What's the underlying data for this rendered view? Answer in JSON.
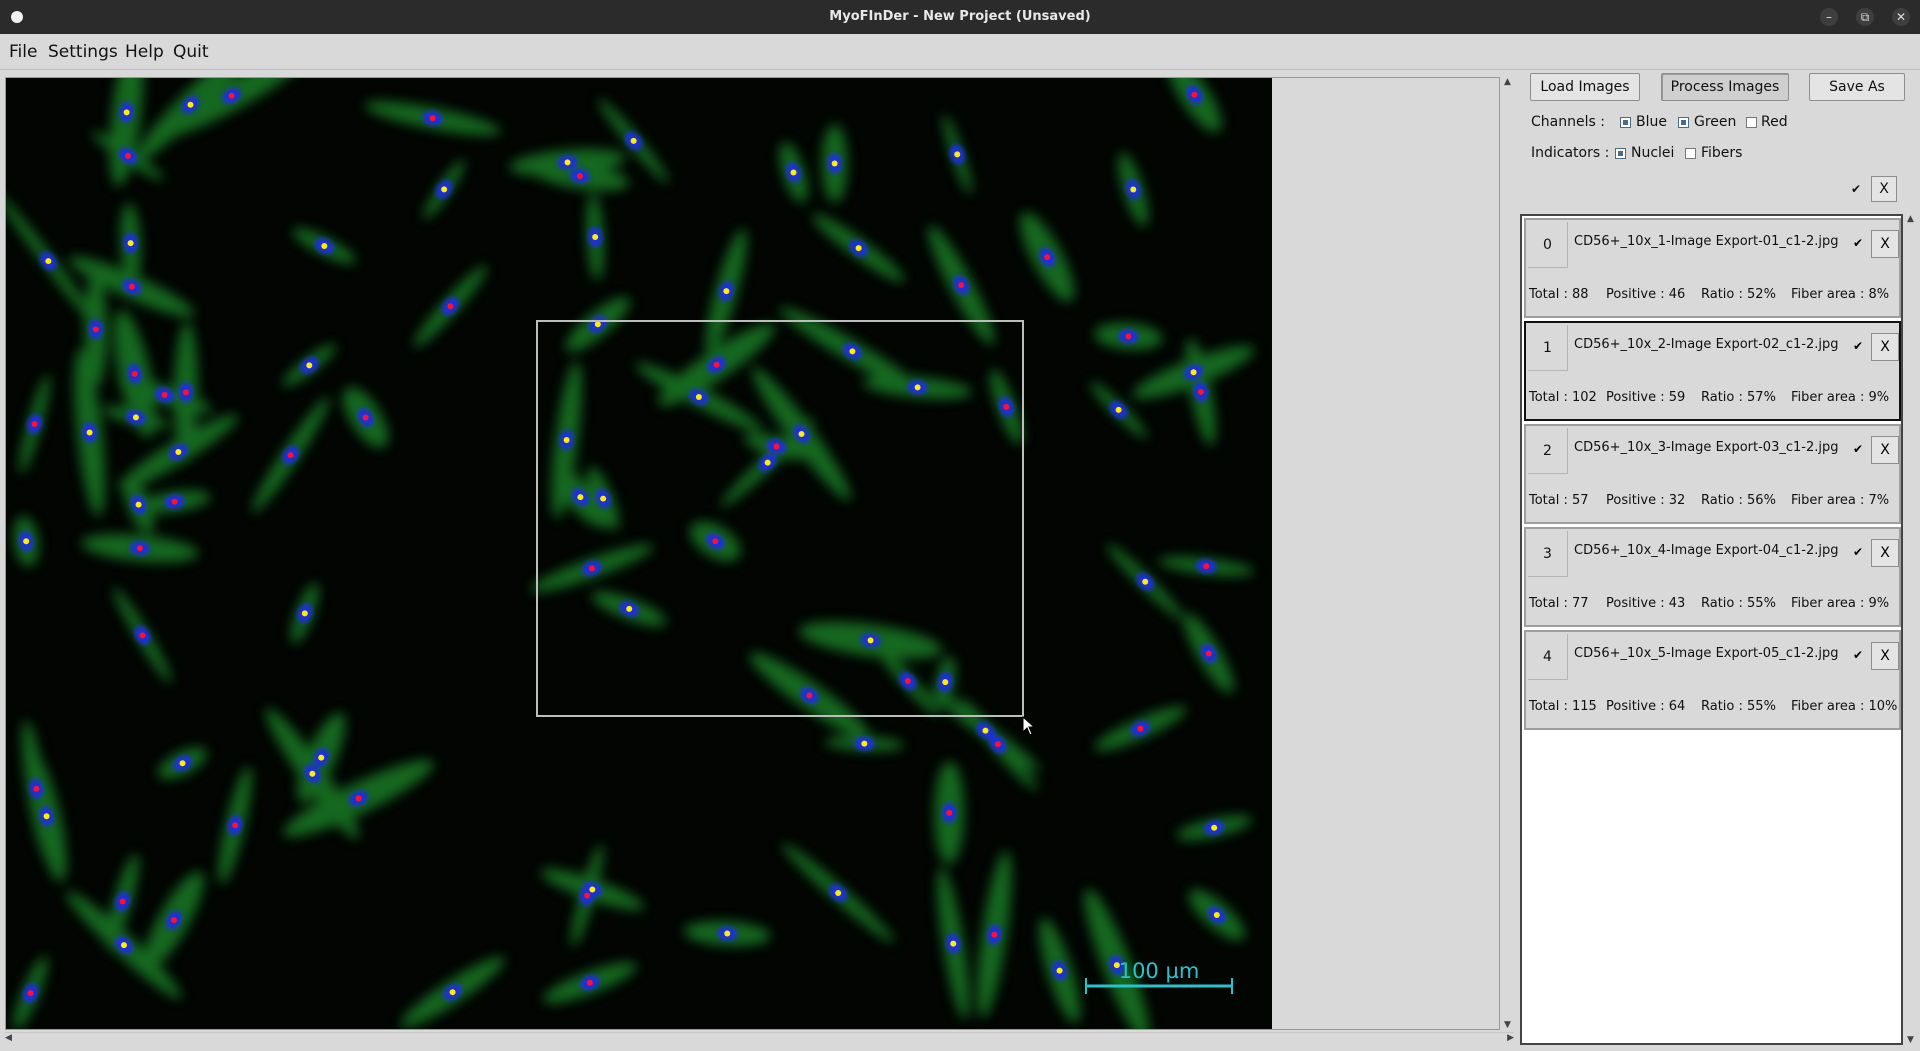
{
  "window": {
    "title": "MyoFInDer - New Project (Unsaved)",
    "controls": {
      "minimize": "–",
      "restore": "⧉",
      "close": "✕"
    }
  },
  "menu": {
    "file": "File",
    "settings": "Settings",
    "help": "Help",
    "quit": "Quit"
  },
  "toolbar": {
    "load": "Load Images",
    "process": "Process Images",
    "save": "Save As"
  },
  "channels": {
    "label": "Channels :",
    "blue": "Blue",
    "green": "Green",
    "red": "Red",
    "blue_on": true,
    "green_on": true,
    "red_on": false
  },
  "indicators": {
    "label": "Indicators :",
    "nuclei": "Nuclei",
    "fibers": "Fibers",
    "nuclei_on": true,
    "fibers_on": false
  },
  "select_all": {
    "check": "✔",
    "close": "X"
  },
  "scale_bar": {
    "text": "100 µm",
    "color": "#27c4cf"
  },
  "colors": {
    "nucleus": "#1c2ee0",
    "fiber": "#1e8a2a",
    "positive": "#ffee00",
    "negative": "#ff1030"
  },
  "images": [
    {
      "index": "0",
      "name": "CD56+_10x_1-Image Export-01_c1-2.jpg",
      "check": "✔",
      "close": "X",
      "total": "Total : 88",
      "positive": "Positive : 46",
      "ratio": "Ratio : 52%",
      "fiber": "Fiber area : 8%"
    },
    {
      "index": "1",
      "name": "CD56+_10x_2-Image Export-02_c1-2.jpg",
      "check": "✔",
      "close": "X",
      "total": "Total : 102",
      "positive": "Positive : 59",
      "ratio": "Ratio : 57%",
      "fiber": "Fiber area : 9%"
    },
    {
      "index": "2",
      "name": "CD56+_10x_3-Image Export-03_c1-2.jpg",
      "check": "✔",
      "close": "X",
      "total": "Total : 57",
      "positive": "Positive : 32",
      "ratio": "Ratio : 56%",
      "fiber": "Fiber area : 7%"
    },
    {
      "index": "3",
      "name": "CD56+_10x_4-Image Export-04_c1-2.jpg",
      "check": "✔",
      "close": "X",
      "total": "Total : 77",
      "positive": "Positive : 43",
      "ratio": "Ratio : 55%",
      "fiber": "Fiber area : 9%"
    },
    {
      "index": "4",
      "name": "CD56+_10x_5-Image Export-05_c1-2.jpg",
      "check": "✔",
      "close": "X",
      "total": "Total : 115",
      "positive": "Positive : 64",
      "ratio": "Ratio : 55%",
      "fiber": "Fiber area : 10%"
    }
  ]
}
